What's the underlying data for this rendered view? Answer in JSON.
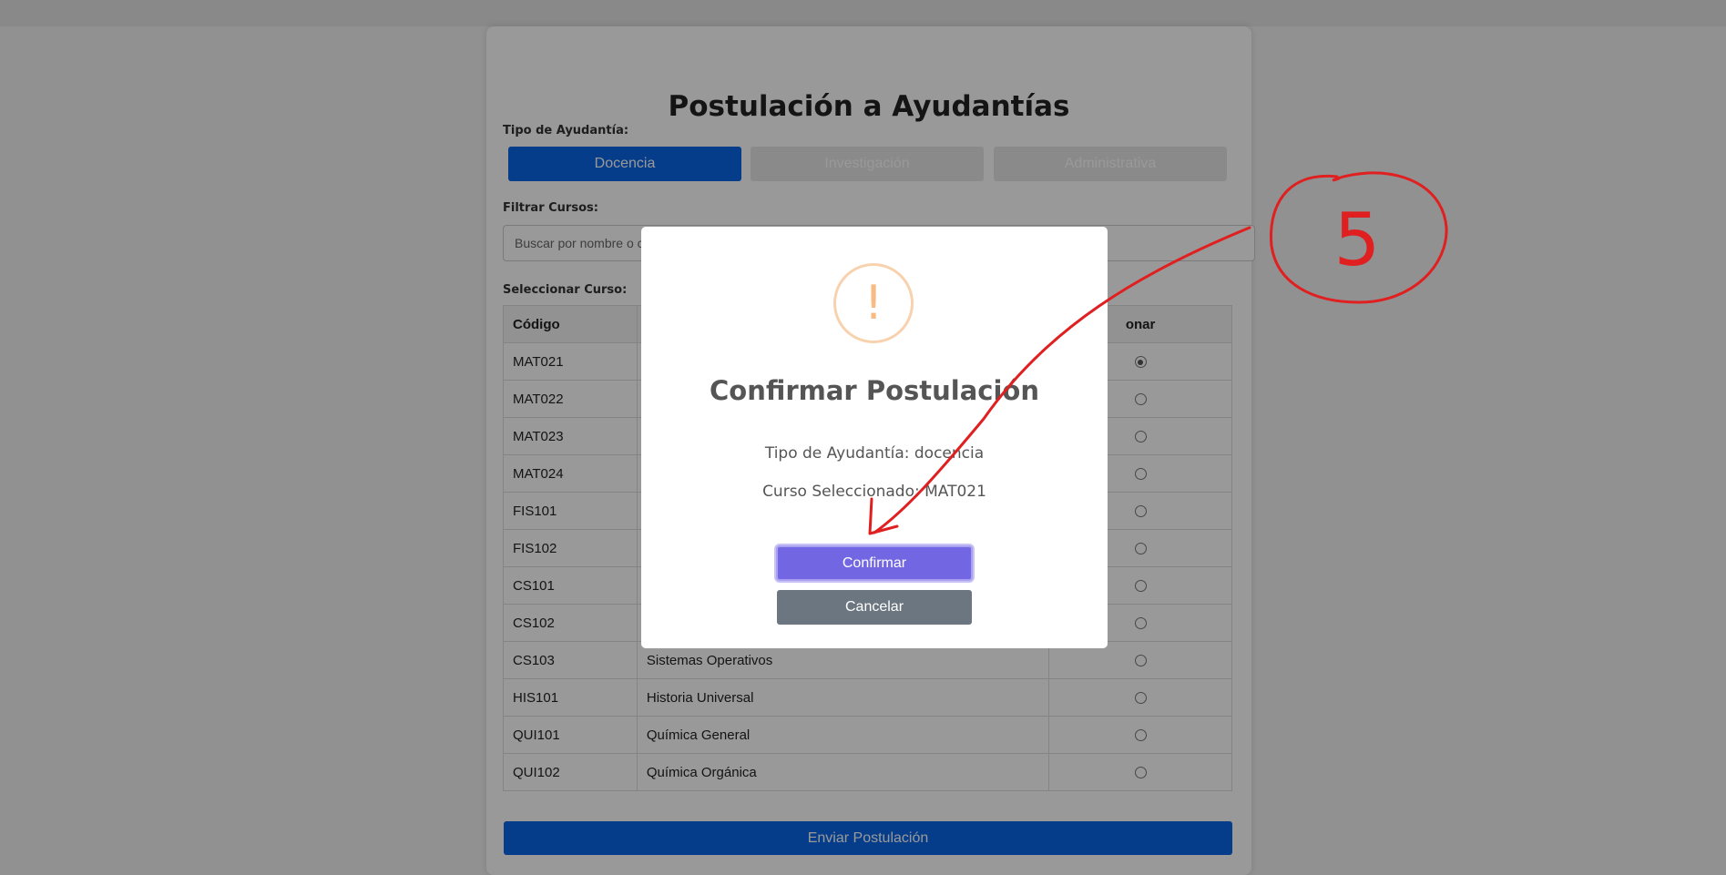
{
  "page": {
    "title": "Postulación a Ayudantías",
    "tipo_label": "Tipo de Ayudantía:",
    "tipo_options": [
      "Docencia",
      "Investigación",
      "Administrativa"
    ],
    "filtrar_label": "Filtrar Cursos:",
    "search_placeholder": "Buscar por nombre o c",
    "seleccionar_label": "Seleccionar Curso:",
    "table_headers": [
      "Código",
      "",
      "onar"
    ],
    "rows": [
      {
        "code": "MAT021",
        "name": "",
        "selected": true
      },
      {
        "code": "MAT022",
        "name": "",
        "selected": false
      },
      {
        "code": "MAT023",
        "name": "",
        "selected": false
      },
      {
        "code": "MAT024",
        "name": "",
        "selected": false
      },
      {
        "code": "FIS101",
        "name": "",
        "selected": false
      },
      {
        "code": "FIS102",
        "name": "",
        "selected": false
      },
      {
        "code": "CS101",
        "name": "",
        "selected": false
      },
      {
        "code": "CS102",
        "name": "",
        "selected": false
      },
      {
        "code": "CS103",
        "name": "Sistemas Operativos",
        "selected": false
      },
      {
        "code": "HIS101",
        "name": "Historia Universal",
        "selected": false
      },
      {
        "code": "QUI101",
        "name": "Química General",
        "selected": false
      },
      {
        "code": "QUI102",
        "name": "Química Orgánica",
        "selected": false
      }
    ],
    "submit_label": "Enviar Postulación"
  },
  "modal": {
    "icon": "!",
    "title": "Confirmar Postulación",
    "line1": "Tipo de Ayudantía: docencia",
    "line2": "Curso Seleccionado: MAT021",
    "confirm_label": "Confirmar",
    "cancel_label": "Cancelar"
  },
  "annotation": {
    "step_number": "5",
    "color": "#e02020"
  },
  "colors": {
    "primary": "#0a66e6",
    "confirm": "#7266e3",
    "cancel": "#6b7680",
    "warning": "#f8bb86"
  }
}
